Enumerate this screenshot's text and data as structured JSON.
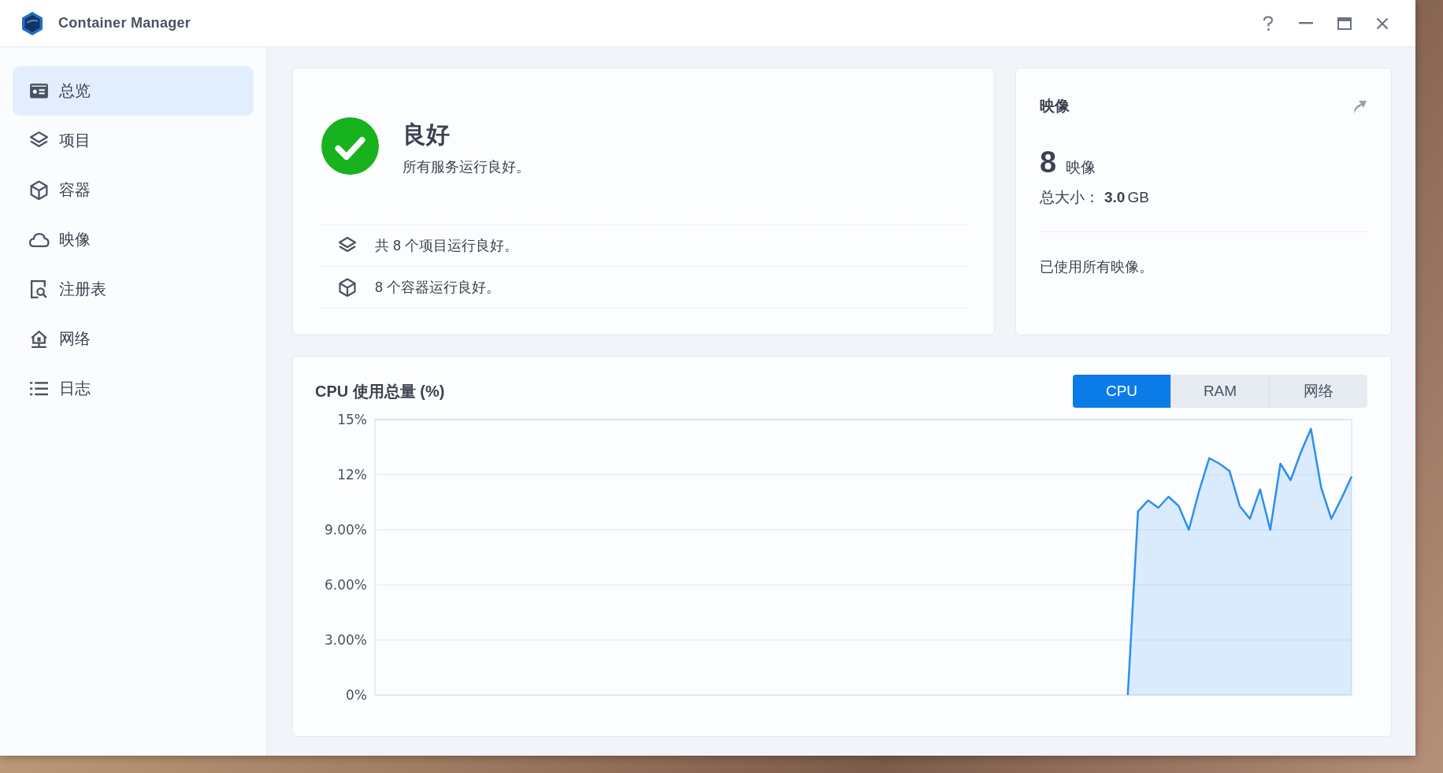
{
  "window": {
    "title": "Container Manager"
  },
  "sidebar": {
    "items": [
      {
        "kind": "overview",
        "label": "总览",
        "selected": true
      },
      {
        "kind": "projects",
        "label": "项目",
        "selected": false
      },
      {
        "kind": "containers",
        "label": "容器",
        "selected": false
      },
      {
        "kind": "images",
        "label": "映像",
        "selected": false
      },
      {
        "kind": "registry",
        "label": "注册表",
        "selected": false
      },
      {
        "kind": "network",
        "label": "网络",
        "selected": false
      },
      {
        "kind": "logs",
        "label": "日志",
        "selected": false
      }
    ]
  },
  "status_card": {
    "healthy": true,
    "title": "良好",
    "subtitle": "所有服务运行良好。",
    "rows": [
      {
        "kind": "projects",
        "text": "共 8 个项目运行良好。"
      },
      {
        "kind": "containers",
        "text": "8 个容器运行良好。"
      }
    ]
  },
  "image_card": {
    "title": "映像",
    "count": "8",
    "count_label": "映像",
    "size_label": "总大小：",
    "size_value": "3.0",
    "size_unit": "GB",
    "note": "已使用所有映像。"
  },
  "chart_panel": {
    "title": "CPU 使用总量 (%)",
    "tabs": [
      {
        "label": "CPU",
        "selected": true
      },
      {
        "label": "RAM",
        "selected": false
      },
      {
        "label": "网络",
        "selected": false
      }
    ],
    "chart_data": {
      "type": "area",
      "grid": true,
      "categories": [
        null,
        null,
        null,
        null,
        null,
        null,
        null,
        null,
        null,
        null,
        null,
        null,
        null,
        null,
        null,
        null,
        null,
        null,
        null,
        null,
        null,
        null,
        null,
        null,
        null,
        null,
        null,
        null,
        null,
        null,
        null,
        null,
        null,
        null,
        null,
        null,
        null,
        null,
        null,
        null,
        null,
        null,
        null,
        null,
        null,
        null,
        null,
        null,
        null,
        null,
        null,
        null,
        null,
        null,
        null,
        null,
        null,
        null,
        null,
        null,
        null,
        null,
        null,
        null,
        null,
        null,
        null,
        null,
        null,
        null,
        null,
        null,
        null,
        null,
        null,
        null,
        null,
        null,
        null,
        null,
        null,
        null,
        null,
        null,
        null,
        null,
        null,
        null,
        null,
        null,
        null,
        null,
        null,
        null,
        null,
        null,
        null
      ],
      "ylim": [
        0,
        15
      ],
      "yticks": [
        {
          "value": 0,
          "label": "0%"
        },
        {
          "value": 3,
          "label": "3.00%"
        },
        {
          "value": 6,
          "label": "6.00%"
        },
        {
          "value": 9,
          "label": "9.00%"
        },
        {
          "value": 12,
          "label": "12%"
        },
        {
          "value": 15,
          "label": "15%"
        }
      ],
      "values": [
        null,
        null,
        null,
        null,
        null,
        null,
        null,
        null,
        null,
        null,
        null,
        null,
        null,
        null,
        null,
        null,
        null,
        null,
        null,
        null,
        null,
        null,
        null,
        null,
        null,
        null,
        null,
        null,
        null,
        null,
        null,
        null,
        null,
        null,
        null,
        null,
        null,
        null,
        null,
        null,
        null,
        null,
        null,
        null,
        null,
        null,
        null,
        null,
        null,
        null,
        null,
        null,
        null,
        null,
        null,
        null,
        null,
        null,
        null,
        null,
        null,
        null,
        null,
        null,
        null,
        null,
        null,
        null,
        null,
        null,
        null,
        null,
        null,
        null,
        0,
        10,
        10.6,
        10.2,
        10.8,
        10.3,
        9.0,
        11.1,
        12.9,
        12.6,
        12.2,
        10.3,
        9.6,
        11.2,
        9.0,
        12.6,
        11.7,
        13.2,
        14.5,
        11.3,
        9.6,
        10.7,
        11.9
      ]
    }
  }
}
